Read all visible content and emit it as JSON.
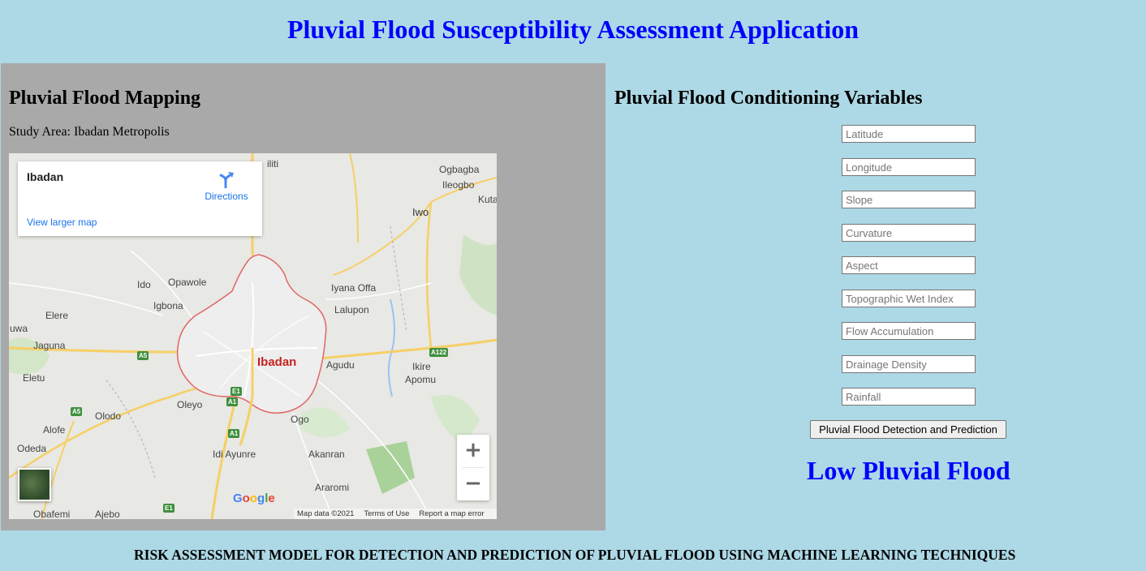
{
  "app": {
    "title": "Pluvial Flood Susceptibility Assessment Application"
  },
  "mapping": {
    "heading": "Pluvial Flood Mapping",
    "study_area": "Study Area: Ibadan Metropolis",
    "map": {
      "info_title": "Ibadan",
      "directions_label": "Directions",
      "view_larger_label": "View larger map",
      "zoom_in": "+",
      "zoom_out": "−",
      "logo_letters": [
        "G",
        "o",
        "o",
        "g",
        "l",
        "e"
      ],
      "attribution": {
        "data": "Map data ©2021",
        "terms": "Terms of Use",
        "report": "Report a map error"
      },
      "places": {
        "ibadan": "Ibadan",
        "iwo": "Iwo",
        "ogbagba": "Ogbagba",
        "ileogbo": "Ileogbo",
        "kuta": "Kuta",
        "ido": "Ido",
        "opawole": "Opawole",
        "iyana_offa": "Iyana Offa",
        "igbona": "Igbona",
        "lalupon": "Lalupon",
        "elere": "Elere",
        "uwa": "uwa",
        "jaguna": "Jaguna",
        "eletu": "Eletu",
        "agudu": "Agudu",
        "ikire": "Ikire",
        "apomu": "Apomu",
        "oleyo": "Oleyo",
        "ologo": "Olodo",
        "alofe": "Alofe",
        "ogo": "Ogo",
        "odeda": "Odeda",
        "idi_ayunre": "Idi Ayunre",
        "akanran": "Akanran",
        "araromi": "Araromi",
        "obafemi": "Obafemi",
        "ajebo": "Ajebo",
        "iliti": "iliti"
      },
      "shields": {
        "a5_1": "A5",
        "a5_2": "A5",
        "a122": "A122",
        "e1": "E1",
        "a1_1": "A1",
        "a1_2": "A1",
        "e1_2": "E1"
      }
    }
  },
  "variables": {
    "heading": "Pluvial Flood Conditioning Variables",
    "fields": [
      {
        "placeholder": "Latitude",
        "value": ""
      },
      {
        "placeholder": "Longitude",
        "value": ""
      },
      {
        "placeholder": "Slope",
        "value": ""
      },
      {
        "placeholder": "Curvature",
        "value": ""
      },
      {
        "placeholder": "Aspect",
        "value": ""
      },
      {
        "placeholder": "Topographic Wet Index",
        "value": ""
      },
      {
        "placeholder": "Flow Accumulation",
        "value": ""
      },
      {
        "placeholder": "Drainage Density",
        "value": ""
      },
      {
        "placeholder": "Rainfall",
        "value": ""
      }
    ],
    "predict_button": "Pluvial Flood Detection and Prediction",
    "result": "Low Pluvial Flood"
  },
  "footer": {
    "text": "RISK ASSESSMENT MODEL FOR DETECTION AND PREDICTION OF PLUVIAL FLOOD USING MACHINE LEARNING TECHNIQUES"
  },
  "colors": {
    "background": "#add8e6",
    "accent": "#0000ff",
    "panel": "#a9a9a9",
    "boundary": "#e06666"
  }
}
